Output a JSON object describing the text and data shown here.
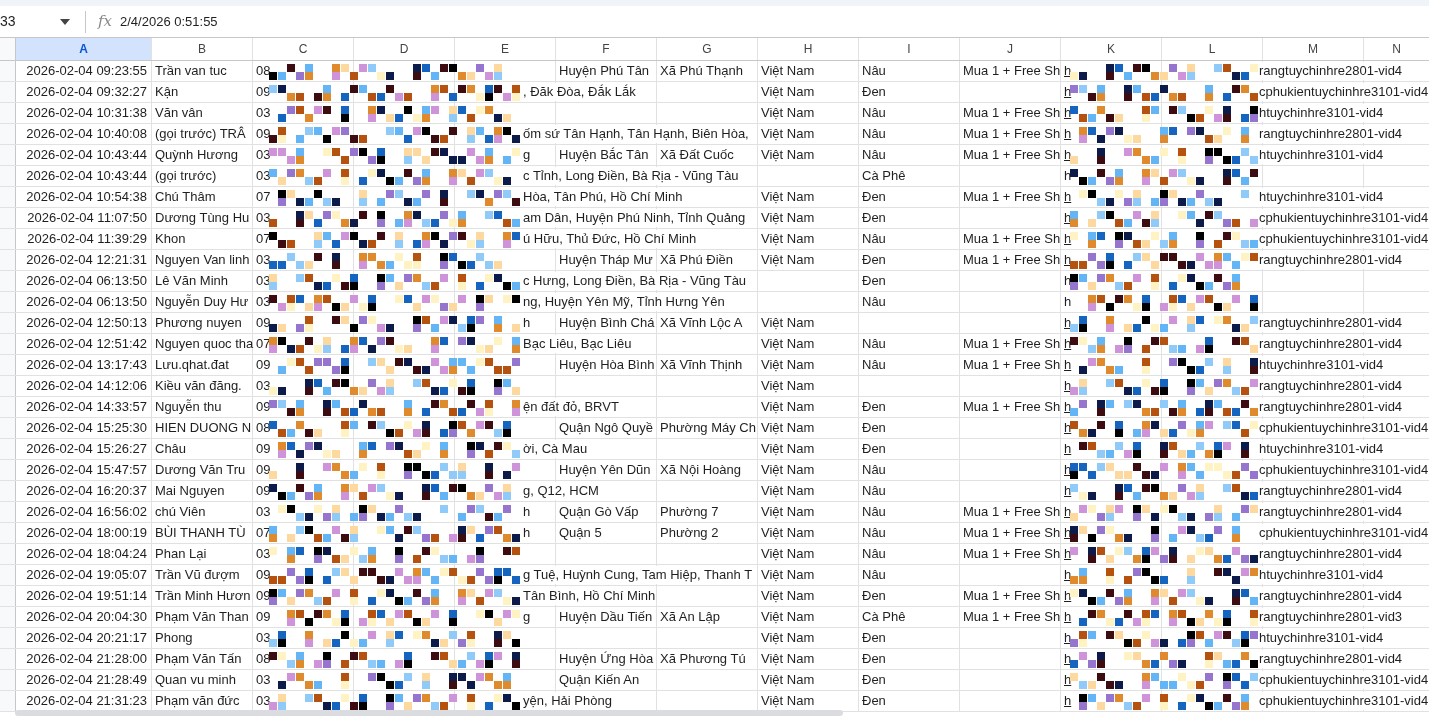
{
  "formula_bar": {
    "name_box": "33",
    "function_icon": "fx",
    "formula": "2/4/2026 0:51:55"
  },
  "columns": [
    {
      "label": "A",
      "selected": true
    },
    {
      "label": "B",
      "selected": false
    },
    {
      "label": "C",
      "selected": false
    },
    {
      "label": "D",
      "selected": false
    },
    {
      "label": "E",
      "selected": false
    },
    {
      "label": "F",
      "selected": false
    },
    {
      "label": "G",
      "selected": false
    },
    {
      "label": "H",
      "selected": false
    },
    {
      "label": "I",
      "selected": false
    },
    {
      "label": "J",
      "selected": false
    },
    {
      "label": "K",
      "selected": false
    },
    {
      "label": "L",
      "selected": false
    },
    {
      "label": "M",
      "selected": false
    },
    {
      "label": "N",
      "selected": false
    }
  ],
  "rows": [
    {
      "a": "2026-02-04 09:23:55",
      "b": "Trần van tuc",
      "c": "08",
      "f": "Huyện Phú Tân",
      "g": "Xã Phú Thạnh",
      "h": "Việt Nam",
      "i": "Nâu",
      "j": "Mua 1 + Free Sh",
      "k": "h",
      "k_link": true,
      "m": "rangtuychinhre2801-vid4"
    },
    {
      "a": "2026-02-04 09:32:27",
      "b": "Kận",
      "c": "09",
      "e": ", Đăk Đòa, Đắk Lắk",
      "h": "Việt Nam",
      "i": "Đen",
      "k": "h",
      "k_link": true,
      "m": "cphukientuychinhre3101-vid4"
    },
    {
      "a": "2026-02-04 10:31:38",
      "b": "Văn vân",
      "c": "03",
      "h": "Việt Nam",
      "i": "Nâu",
      "j": "Mua 1 + Free Sh",
      "k": "h",
      "k_link": true,
      "m": "htuychinhre3101-vid4"
    },
    {
      "a": "2026-02-04 10:40:08",
      "b": "(gọi trước) TRÂ",
      "c": "09",
      "e": "ốm sứ Tân Hạnh, Tân Hạnh, Biên Hòa,",
      "h": "Việt Nam",
      "i": "Nâu",
      "j": "Mua 1 + Free Sh",
      "k": "h",
      "k_link": true,
      "m": "rangtuychinhre2801-vid4"
    },
    {
      "a": "2026-02-04 10:43:44",
      "b": "Quỳnh Hương",
      "c": "03",
      "e": "g",
      "f": "Huyện Bắc Tân",
      "g": "Xã Đất Cuốc",
      "h": "Việt Nam",
      "i": "Nâu",
      "j": "Mua 1 + Free Sh",
      "k": "h",
      "k_link": true,
      "m": "htuychinhre3101-vid4"
    },
    {
      "a": "2026-02-04 10:43:44",
      "b": "(gọi trước)",
      "c": "03",
      "e": "c Tỉnh, Long Điền, Bà Rịa - Vũng Tàu",
      "i": "Cà Phê",
      "k": "h",
      "k_link": false
    },
    {
      "a": "2026-02-04 10:54:38",
      "b": "Chú  Thâm",
      "c": "07",
      "e": "Hòa, Tân Phú, Hồ Chí Minh",
      "h": "Việt Nam",
      "i": "Đen",
      "j": "Mua 1 + Free Sh",
      "k": "h",
      "k_link": true,
      "m": "htuychinhre3101-vid4"
    },
    {
      "a": "2026-02-04 11:07:50",
      "b": "Dương Tùng Hu",
      "c": "03",
      "e": "am Dân, Huyện Phú Ninh, Tỉnh Quảng",
      "h": "Việt Nam",
      "i": "Đen",
      "k": "h",
      "k_link": true,
      "m": "cphukientuychinhre3101-vid4"
    },
    {
      "a": "2026-02-04 11:39:29",
      "b": "Khon",
      "c": "07",
      "e": "ú Hữu, Thủ Đức, Hồ Chí Minh",
      "h": "Việt Nam",
      "i": "Nâu",
      "j": "Mua 1 + Free Sh",
      "k": "h",
      "k_link": true,
      "m": "cphukientuychinhre3101-vid4"
    },
    {
      "a": "2026-02-04 12:21:31",
      "b": "Nguyen Van linh",
      "c": "03",
      "f": "Huyện Tháp Mư",
      "g": "Xã Phú Điền",
      "h": "Việt Nam",
      "i": "Đen",
      "j": "Mua 1 + Free Sh",
      "k": "h",
      "k_link": true,
      "m": "rangtuychinhre2801-vid4"
    },
    {
      "a": "2026-02-04 06:13:50",
      "b": "Lê Văn Minh",
      "c": "03",
      "e": "c Hưng, Long Điền, Bà Rịa - Vũng Tàu",
      "i": "Đen",
      "k": "h",
      "k_link": false
    },
    {
      "a": "2026-02-04 06:13:50",
      "b": "Nguyễn Duy Hư",
      "c": "03",
      "e": "ng, Huyện Yên Mỹ, Tỉnh Hưng Yên",
      "i": "Nâu",
      "k": "h",
      "k_link": false
    },
    {
      "a": "2026-02-04 12:50:13",
      "b": "Phương nuyen",
      "c": "09",
      "e": "h",
      "f": "Huyện Bình Chá",
      "g": "Xã Vĩnh Lộc A",
      "h": "Việt Nam",
      "k": "h",
      "k_link": true,
      "m": "rangtuychinhre2801-vid4"
    },
    {
      "a": "2026-02-04 12:51:42",
      "b": "Nguyen quoc tha",
      "c": "07",
      "e": "Bạc Liêu, Bạc Liêu",
      "h": "Việt Nam",
      "i": "Nâu",
      "j": "Mua 1 + Free Sh",
      "k": "h",
      "k_link": true,
      "m": "rangtuychinhre2801-vid4"
    },
    {
      "a": "2026-02-04 13:17:43",
      "b": "Lưu.qhat.đat",
      "c": "09",
      "f": "Huyện Hòa Bình",
      "g": "Xã Vĩnh Thịnh",
      "h": "Việt Nam",
      "i": "Nâu",
      "j": "Mua 1 + Free Sh",
      "k": "h",
      "k_link": true,
      "m": "htuychinhre3101-vid4"
    },
    {
      "a": "2026-02-04 14:12:06",
      "b": "Kiều văn đăng.",
      "c": "03",
      "h": "Việt Nam",
      "k": "h",
      "k_link": true,
      "m": "rangtuychinhre2801-vid4"
    },
    {
      "a": "2026-02-04 14:33:57",
      "b": "Nguyễn thu",
      "c": "09",
      "e": "ện đất đỏ, BRVT",
      "h": "Việt Nam",
      "i": "Đen",
      "j": "Mua 1 + Free Sh",
      "k": "h",
      "k_link": true,
      "m": "rangtuychinhre2801-vid4"
    },
    {
      "a": "2026-02-04 15:25:30",
      "b": "HIEN DUONG N",
      "c": "08",
      "f": "Quận Ngô Quyề",
      "g": "Phường Máy Ch",
      "h": "Việt Nam",
      "i": "Đen",
      "k": "h",
      "k_link": true,
      "m": "cphukientuychinhre3101-vid4"
    },
    {
      "a": "2026-02-04 15:26:27",
      "b": "Châu",
      "c": "09",
      "e": "ời, Cà Mau",
      "h": "Việt Nam",
      "i": "Đen",
      "k": "h",
      "k_link": true,
      "m": "htuychinhre3101-vid4"
    },
    {
      "a": "2026-02-04 15:47:57",
      "b": "Dương Văn Tru",
      "c": "09",
      "f": "Huyện Yên Dũn",
      "g": "Xã Nội Hoàng",
      "h": "Việt Nam",
      "i": "Nâu",
      "k": "h",
      "k_link": true,
      "m": "cphukientuychinhre3101-vid4"
    },
    {
      "a": "2026-02-04 16:20:37",
      "b": "Mai Nguyen",
      "c": "09",
      "e": "g, Q12, HCM",
      "h": "Việt Nam",
      "i": "Nâu",
      "k": "h",
      "k_link": true,
      "m": "rangtuychinhre2801-vid4"
    },
    {
      "a": "2026-02-04 16:56:02",
      "b": "chú Viên",
      "c": "03",
      "e": "h",
      "f": "Quận Gò Vấp",
      "g": "Phường 7",
      "h": "Việt Nam",
      "i": "Nâu",
      "j": "Mua 1 + Free Sh",
      "k": "h",
      "k_link": true,
      "m": "rangtuychinhre2801-vid4"
    },
    {
      "a": "2026-02-04 18:00:19",
      "b": "BÙI THANH TÙ",
      "c": "07",
      "e": "h",
      "f": "Quận 5",
      "g": "Phường 2",
      "h": "Việt Nam",
      "i": "Nâu",
      "j": "Mua 1 + Free Sh",
      "k": "h",
      "k_link": true,
      "m": "cphukientuychinhre3101-vid4"
    },
    {
      "a": "2026-02-04 18:04:24",
      "b": "Phan Lại",
      "c": "03",
      "h": "Việt Nam",
      "i": "Nâu",
      "j": "Mua 1 + Free Sh",
      "k": "h",
      "k_link": true,
      "m": "rangtuychinhre2801-vid4"
    },
    {
      "a": "2026-02-04 19:05:07",
      "b": "Trần Vũ đượm",
      "c": "09",
      "e": "g Tuệ, Huỳnh Cung, Tam Hiệp, Thanh T",
      "h": "Việt Nam",
      "i": "Nâu",
      "k": "h",
      "k_link": true,
      "m": "htuychinhre3101-vid4"
    },
    {
      "a": "2026-02-04 19:51:14",
      "b": "Trần Minh Hươn",
      "c": "09",
      "e": "Tân Bình, Hồ Chí Minh",
      "h": "Việt Nam",
      "i": "Đen",
      "j": "Mua 1 + Free Sh",
      "k": "h",
      "k_link": true,
      "m": "rangtuychinhre2801-vid4"
    },
    {
      "a": "2026-02-04 20:04:30",
      "b": "Phạm Văn Than",
      "c": "09",
      "e": "g",
      "f": "Huyện Dầu Tiến",
      "g": "Xã An Lập",
      "h": "Việt Nam",
      "i": "Cà Phê",
      "j": "Mua 1 + Free Sh",
      "k": "h",
      "k_link": true,
      "m": "rangtuychinhre2801-vid3"
    },
    {
      "a": "2026-02-04 20:21:17",
      "b": "Phong",
      "c": "03",
      "h": "Việt Nam",
      "i": "Đen",
      "k": "h",
      "k_link": true,
      "m": "htuychinhre3101-vid4"
    },
    {
      "a": "2026-02-04 21:28:00",
      "b": "Phạm Văn Tấn",
      "c": "08",
      "f": "Huyện Ứng Hòa",
      "g": "Xã Phương Tú",
      "h": "Việt Nam",
      "i": "Đen",
      "k": "h",
      "k_link": true,
      "m": "rangtuychinhre2801-vid4"
    },
    {
      "a": "2026-02-04 21:28:49",
      "b": "Quan vu minh",
      "c": "03",
      "f": "Quận Kiến An",
      "h": "Việt Nam",
      "i": "Đen",
      "k": "h",
      "k_link": true,
      "m": "cphukientuychinhre3101-vid4"
    },
    {
      "a": "2026-02-04 21:31:23",
      "b": "Phạm văn đức",
      "c": "03",
      "e": "yện, Hải Phòng",
      "h": "Việt Nam",
      "i": "Đen",
      "k": "h",
      "k_link": true,
      "m": "cphukientuychinhre3101-vid4"
    }
  ]
}
